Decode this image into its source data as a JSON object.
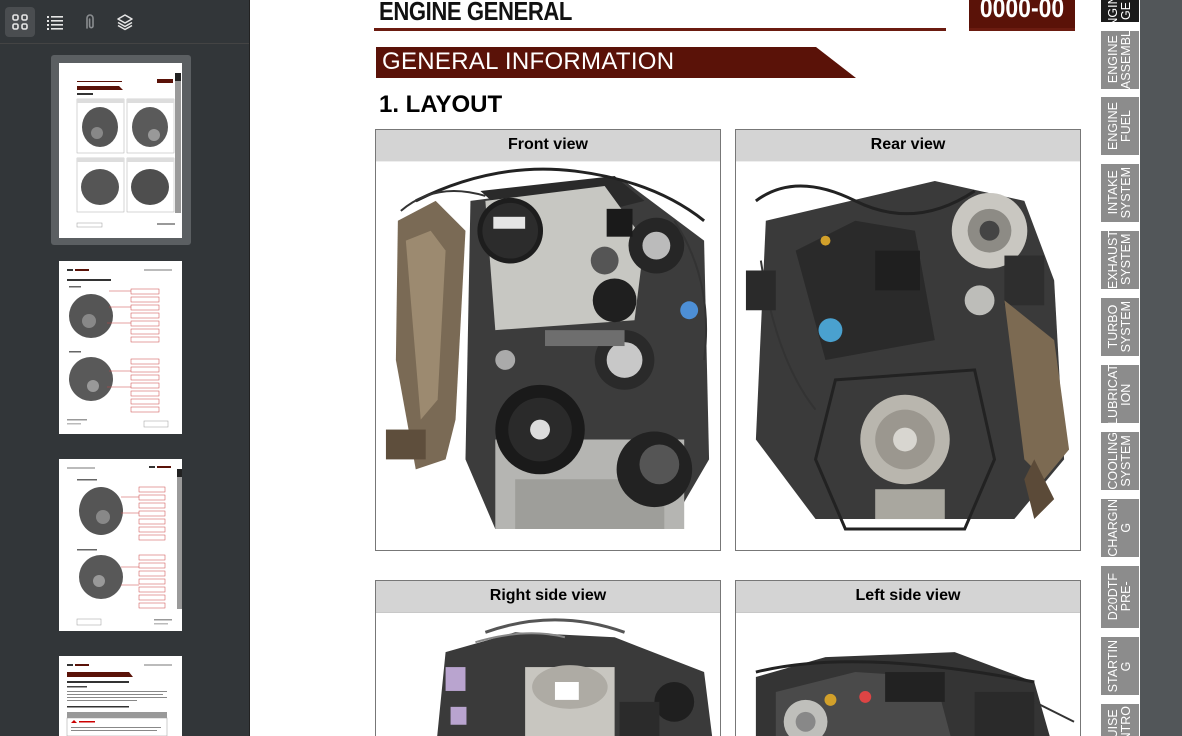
{
  "sidebar": {
    "toolbar": [
      {
        "name": "thumbnails-icon",
        "active": true
      },
      {
        "name": "outline-icon",
        "active": false
      },
      {
        "name": "attachments-icon",
        "active": false
      },
      {
        "name": "layers-icon",
        "active": false
      }
    ],
    "thumbnails": [
      {
        "page": 1,
        "selected": true
      },
      {
        "page": 2,
        "selected": false
      },
      {
        "page": 3,
        "selected": false
      },
      {
        "page": 4,
        "selected": false
      }
    ]
  },
  "page": {
    "header_title": "ENGINE GENERAL",
    "header_code": "0000-00",
    "section_banner": "GENERAL INFORMATION",
    "heading": "1. LAYOUT",
    "views": [
      {
        "label": "Front view"
      },
      {
        "label": "Rear view"
      },
      {
        "label": "Right side view"
      },
      {
        "label": "Left side view"
      }
    ]
  },
  "tabs": [
    {
      "label": "ENGINE\nGE",
      "active": true
    },
    {
      "label": "ENGINE\nASSEMBL",
      "active": false
    },
    {
      "label": "ENGINE\nFUEL",
      "active": false
    },
    {
      "label": "INTAKE\nSYSTEM",
      "active": false
    },
    {
      "label": "EXHAUST\nSYSTEM",
      "active": false
    },
    {
      "label": "TURBO\nSYSTEM",
      "active": false
    },
    {
      "label": "LUBRICAT\nION",
      "active": false
    },
    {
      "label": "COOLING\nSYSTEM",
      "active": false
    },
    {
      "label": "CHARGIN\nG",
      "active": false
    },
    {
      "label": "D20DTF\nPRE-",
      "active": false
    },
    {
      "label": "STARTIN\nG",
      "active": false
    },
    {
      "label": "UISE\nNTRO",
      "active": false
    }
  ],
  "colors": {
    "banner": "#5a1208",
    "tab_active": "#1b1b1b",
    "tab_inactive": "#8c8c8c",
    "sidebar_bg": "#323639",
    "viewer_bg": "#525659"
  }
}
